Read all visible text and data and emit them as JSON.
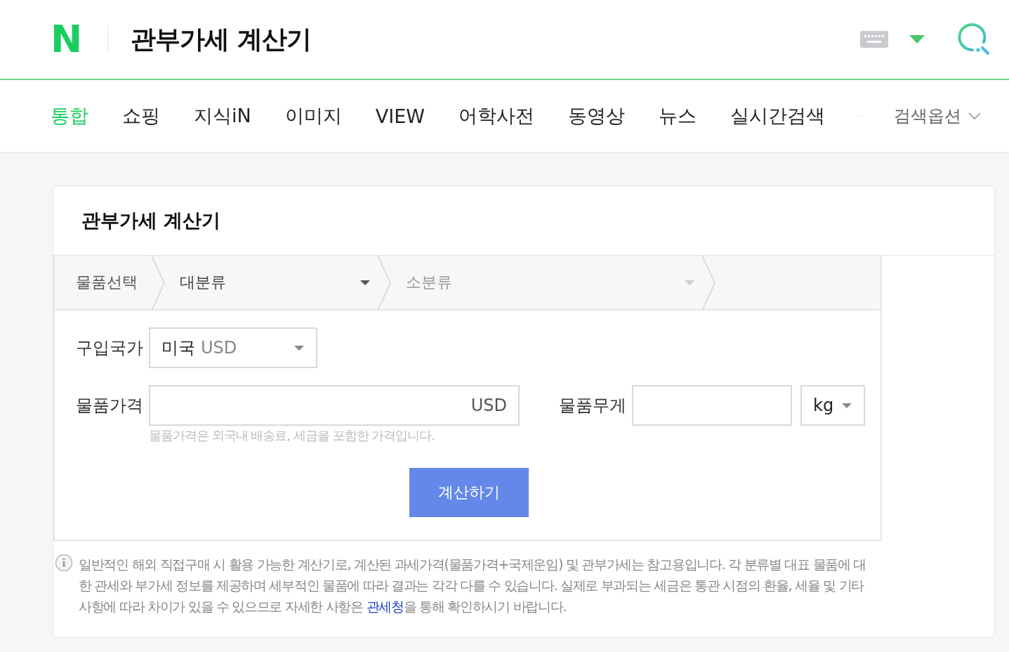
{
  "header": {
    "logo": "N",
    "title": "관부가세 계산기"
  },
  "nav": {
    "tabs": [
      {
        "label": "통합",
        "selected": true
      },
      {
        "label": "쇼핑",
        "selected": false
      },
      {
        "label": "지식iN",
        "selected": false
      },
      {
        "label": "이미지",
        "selected": false
      },
      {
        "label": "VIEW",
        "selected": false
      },
      {
        "label": "어학사전",
        "selected": false
      },
      {
        "label": "동영상",
        "selected": false
      },
      {
        "label": "뉴스",
        "selected": false
      },
      {
        "label": "실시간검색",
        "selected": false
      }
    ],
    "search_options": "검색옵션"
  },
  "card": {
    "title": "관부가세 계산기",
    "breadcrumb": {
      "label": "물품선택",
      "selects": [
        {
          "value": "대분류",
          "disabled": false
        },
        {
          "value": "소분류",
          "disabled": true
        }
      ]
    },
    "country": {
      "label": "구입국가",
      "value": "미국",
      "currency": "USD"
    },
    "price": {
      "label": "물품가격",
      "unit": "USD",
      "hint": "물품가격은 외국내 배송료, 세금을 포함한 가격입니다."
    },
    "weight": {
      "label": "물품무게",
      "unit": "kg"
    },
    "button": "계산하기",
    "notice": {
      "before": "일반적인 해외 직접구매 시 활용 가능한 계산기로, 계산된 과세가격(물품가격+국제운임) 및 관부가세는 참고용입니다. 각 분류별 대표 물품에 대한 관세와 부가세 정보를 제공하며 세부적인 물품에 따라 결과는 각각 다를 수 있습니다. 실제로 부과되는 세금은 통관 시점의 환율, 세율 및 기타 사항에 따라 차이가 있을 수 있으므로 자세한 사항은 ",
      "link": "관세청",
      "after": "을 통해 확인하시기 바랍니다."
    }
  }
}
